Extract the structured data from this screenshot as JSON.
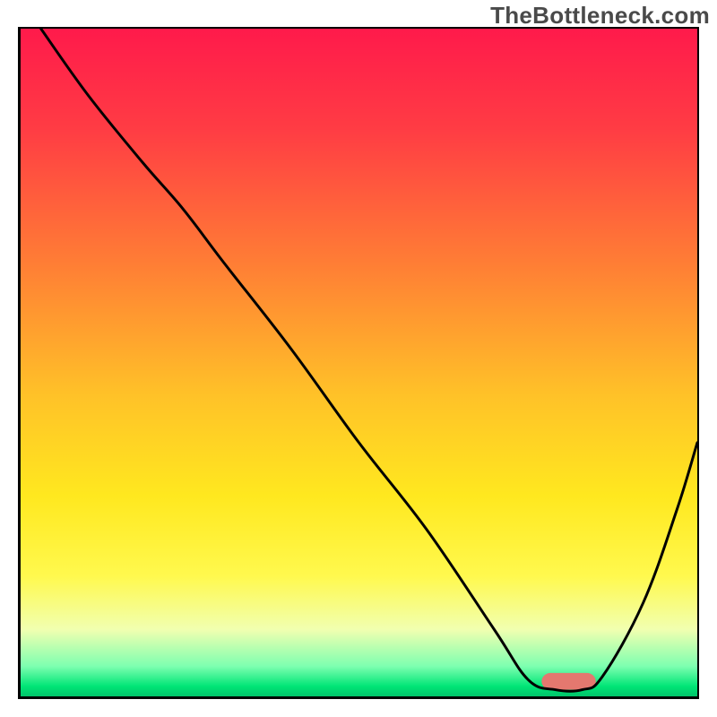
{
  "watermark": "TheBottleneck.com",
  "chart_data": {
    "type": "line",
    "title": "",
    "xlabel": "",
    "ylabel": "",
    "xlim": [
      0,
      100
    ],
    "ylim": [
      0,
      100
    ],
    "background_gradient": {
      "stops": [
        {
          "offset": 0.0,
          "color": "#ff1a4b"
        },
        {
          "offset": 0.15,
          "color": "#ff3c44"
        },
        {
          "offset": 0.35,
          "color": "#ff7d35"
        },
        {
          "offset": 0.55,
          "color": "#ffc228"
        },
        {
          "offset": 0.7,
          "color": "#ffe81f"
        },
        {
          "offset": 0.82,
          "color": "#fff94e"
        },
        {
          "offset": 0.9,
          "color": "#f1ffb0"
        },
        {
          "offset": 0.955,
          "color": "#7dffb0"
        },
        {
          "offset": 0.985,
          "color": "#00e576"
        },
        {
          "offset": 1.0,
          "color": "#00c46a"
        }
      ]
    },
    "series": [
      {
        "name": "curve",
        "stroke": "#000000",
        "x": [
          3,
          10,
          18,
          24,
          30,
          40,
          50,
          60,
          70,
          75,
          79,
          83,
          86,
          92,
          97,
          100
        ],
        "y": [
          100,
          90,
          80,
          73,
          65,
          52,
          38,
          25,
          10,
          2.5,
          1,
          1,
          3,
          14,
          28,
          38
        ]
      }
    ],
    "marker": {
      "name": "optimal-zone",
      "color": "#e4786f",
      "x_start": 77,
      "x_end": 85,
      "y": 1,
      "height": 2.5,
      "radius": 10
    }
  }
}
